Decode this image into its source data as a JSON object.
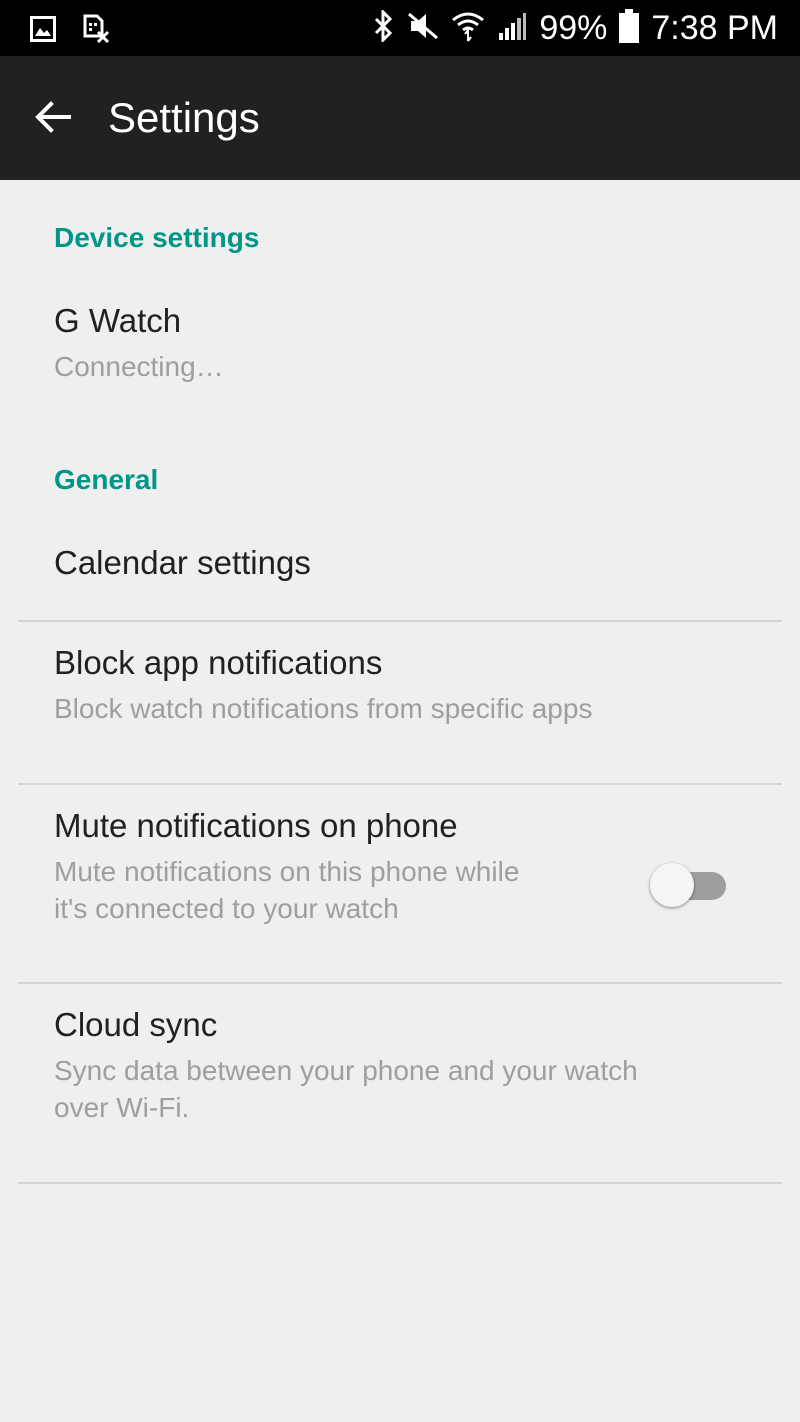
{
  "status_bar": {
    "left_icons": [
      "gallery-icon",
      "sim-error-icon"
    ],
    "right_icons": [
      "bluetooth-icon",
      "mute-icon",
      "wifi-icon",
      "signal-icon",
      "battery-icon"
    ],
    "battery": "99%",
    "time": "7:38 PM"
  },
  "app_bar": {
    "title": "Settings",
    "back_icon": "arrow-back-icon"
  },
  "sections": {
    "device": {
      "header": "Device settings",
      "device_name": "G Watch",
      "device_status": "Connecting…"
    },
    "general": {
      "header": "General",
      "calendar": {
        "title": "Calendar settings"
      },
      "block": {
        "title": "Block app notifications",
        "subtitle": "Block watch notifications from specific apps"
      },
      "mute": {
        "title": "Mute notifications on phone",
        "subtitle_line1": "Mute notifications on this phone while",
        "subtitle_line2": "it's connected to your watch",
        "enabled": false
      },
      "cloud": {
        "title": "Cloud sync",
        "subtitle_line1": "Sync data between your phone and your watch",
        "subtitle_line2": "over Wi-Fi."
      }
    }
  },
  "colors": {
    "accent": "#009688",
    "app_bar": "#212121",
    "background": "#efefef"
  }
}
